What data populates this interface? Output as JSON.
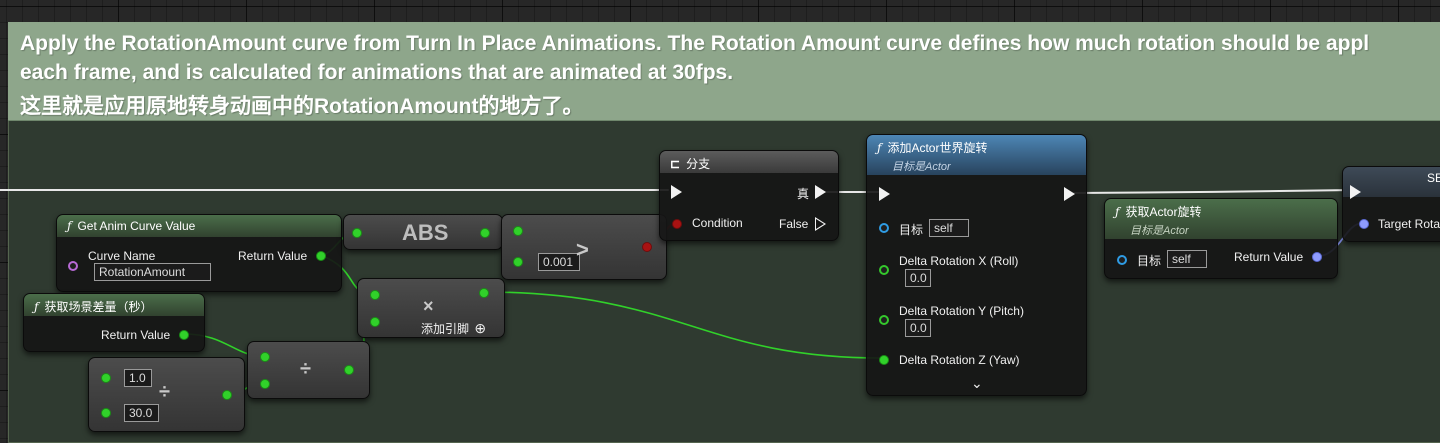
{
  "comment": {
    "line1": "Apply the RotationAmount curve from Turn In Place Animations. The Rotation Amount curve defines how much rotation should be appl",
    "line2": "each frame, and is calculated for animations that are animated at 30fps.",
    "line3": "这里就是应用原地转身动画中的RotationAmount的地方了。"
  },
  "nodes": {
    "get_curve": {
      "title": "Get Anim Curve Value",
      "curve_label": "Curve Name",
      "curve_value": "RotationAmount",
      "return_label": "Return Value"
    },
    "delta_seconds": {
      "title": "获取场景差量（秒）",
      "return_label": "Return Value"
    },
    "abs": {
      "label": "ABS"
    },
    "greater": {
      "op": ">",
      "value": "0.001"
    },
    "multiply": {
      "op": "×",
      "add_pin": "添加引脚",
      "add_icon": "⊕"
    },
    "divide_small": {
      "op": "÷",
      "a": "1.0",
      "b": "30.0"
    },
    "divide_big": {
      "op": "÷"
    },
    "branch": {
      "title": "分支",
      "condition": "Condition",
      "true_label": "真",
      "false_label": "False"
    },
    "add_world_rotation": {
      "title": "添加Actor世界旋转",
      "subtitle": "目标是Actor",
      "target_label": "目标",
      "target_value": "self",
      "roll_label": "Delta Rotation X (Roll)",
      "roll_value": "0.0",
      "pitch_label": "Delta Rotation Y (Pitch)",
      "pitch_value": "0.0",
      "yaw_label": "Delta Rotation Z (Yaw)",
      "expand": "⌄"
    },
    "get_rotation": {
      "title": "获取Actor旋转",
      "subtitle": "目标是Actor",
      "target_label": "目标",
      "target_value": "self",
      "return_label": "Return Value"
    },
    "set_node": {
      "title": "SE",
      "target_label": "Target Rota"
    }
  },
  "colors": {
    "exec": "#f2f2f2",
    "float": "#31d12a",
    "object": "#2f9ce4",
    "bool": "#a81212",
    "rotator": "#8f9cff",
    "name": "#b86ad6"
  }
}
